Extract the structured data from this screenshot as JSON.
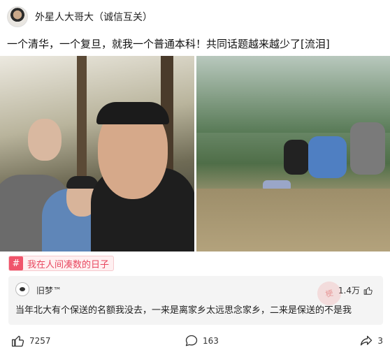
{
  "header": {
    "username": "外星人大哥大（诚信互关）"
  },
  "post": {
    "text": "一个清华，一个复旦，就我一个普通本科！共同话题越来越少了[流泪]"
  },
  "topic": {
    "icon": "#",
    "label": "我在人间凑数的日子"
  },
  "comment": {
    "author": "旧梦™",
    "likes": "1.4万",
    "text": "当年北大有个保送的名额我没去，一来是离家乡太远思念家乡，二来是保送的不是我",
    "watermark": "梗"
  },
  "actions": {
    "likes": "7257",
    "comments": "163",
    "shares": "3"
  },
  "colors": {
    "accent": "#e8475f",
    "tag_bg": "#fff0f1",
    "comment_bg": "#f4f4f4"
  }
}
